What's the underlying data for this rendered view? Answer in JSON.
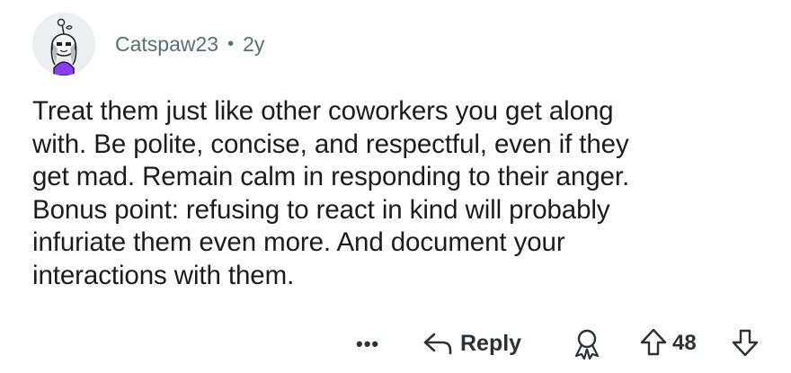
{
  "comment": {
    "author": "Catspaw23",
    "separator": "•",
    "age": "2y",
    "body_lines": [
      "Treat them just like other coworkers you get along",
      "with. Be polite, concise, and respectful, even if they",
      "get mad. Remain calm in responding to their anger.",
      "Bonus point: refusing to react in kind will probably",
      "infuriate them even more. And document your",
      "interactions with them."
    ]
  },
  "actions": {
    "more_label": "•••",
    "reply_label": "Reply",
    "score": "48"
  },
  "icons": {
    "avatar": "snoo-avatar",
    "more": "ellipsis-icon",
    "reply": "reply-arrow-icon",
    "award": "award-icon",
    "upvote": "upvote-arrow-icon",
    "downvote": "downvote-arrow-icon"
  },
  "colors": {
    "meta_text": "#576f76",
    "body_text": "#1c1c1c",
    "action_text": "#2a3236",
    "avatar_bg": "#eceef0",
    "avatar_accent": "#8b3df0"
  }
}
